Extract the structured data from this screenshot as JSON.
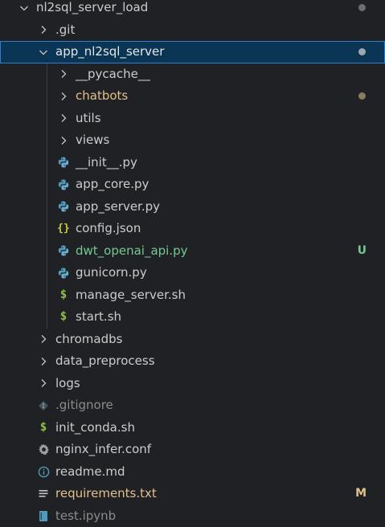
{
  "explorer": {
    "root": {
      "label": "nl2sql_server_load"
    },
    "git_folder": {
      "label": ".git"
    },
    "app_folder": {
      "label": "app_nl2sql_server"
    },
    "pycache_folder": {
      "label": "__pycache__"
    },
    "chatbots_folder": {
      "label": "chatbots"
    },
    "utils_folder": {
      "label": "utils"
    },
    "views_folder": {
      "label": "views"
    },
    "init_py": {
      "label": "__init__.py"
    },
    "app_core_py": {
      "label": "app_core.py"
    },
    "app_server_py": {
      "label": "app_server.py"
    },
    "config_json": {
      "label": "config.json"
    },
    "dwt_openai_api_py": {
      "label": "dwt_openai_api.py",
      "badge": "U"
    },
    "gunicorn_py": {
      "label": "gunicorn.py"
    },
    "manage_server_sh": {
      "label": "manage_server.sh"
    },
    "start_sh": {
      "label": "start.sh"
    },
    "chromadbs_folder": {
      "label": "chromadbs"
    },
    "data_preprocess_folder": {
      "label": "data_preprocess"
    },
    "logs_folder": {
      "label": "logs"
    },
    "gitignore": {
      "label": ".gitignore"
    },
    "init_conda_sh": {
      "label": "init_conda.sh"
    },
    "nginx_infer_conf": {
      "label": "nginx_infer.conf"
    },
    "readme_md": {
      "label": "readme.md"
    },
    "requirements_txt": {
      "label": "requirements.txt",
      "badge": "M"
    },
    "test_ipynb": {
      "label": "test.ipynb"
    }
  },
  "colors": {
    "modified": "#e2c08d",
    "untracked": "#73c991",
    "ignored": "#8c8c8c",
    "python_icon": "#519aba",
    "json_icon": "#cbcb41",
    "shell_icon": "#8dc149",
    "selection": "#0b3554",
    "selection_border": "#2f7ec9"
  }
}
